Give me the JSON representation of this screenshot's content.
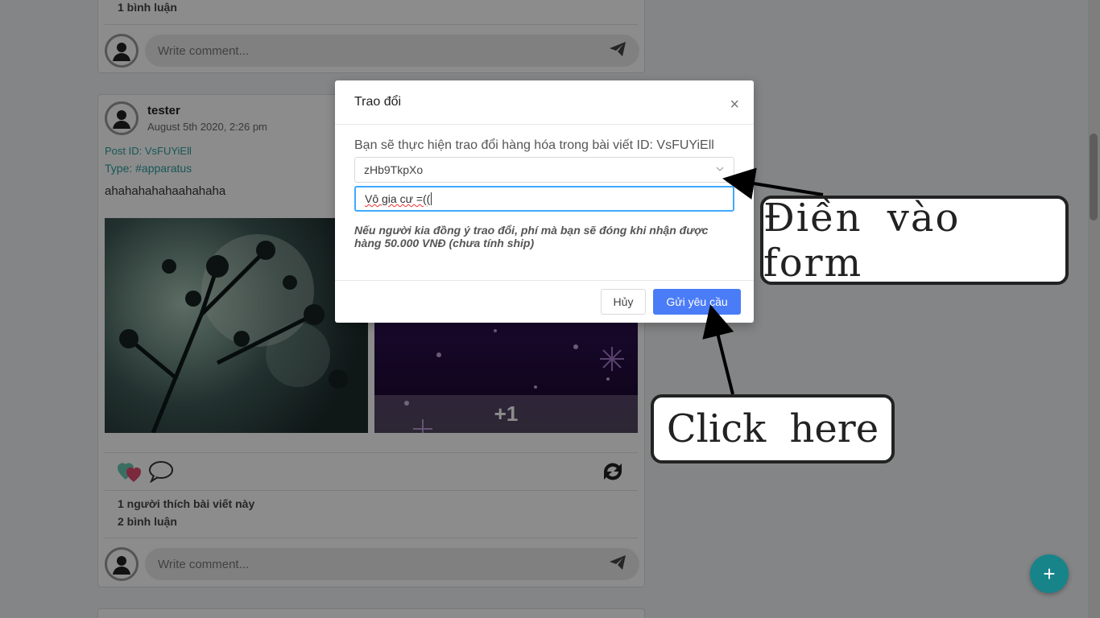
{
  "feed": {
    "post_prev": {
      "comments_count": "1 bình luận",
      "comment_placeholder": "Write comment..."
    },
    "post": {
      "author": "tester",
      "date": "August 5th 2020, 2:26 pm",
      "post_id": "Post ID: VsFUYiEll",
      "type": "Type: #apparatus",
      "content": "ahahahahahaahahaha",
      "more_images": "+1",
      "likes": "1 người thích bài viết này",
      "comments_count": "2 bình luận",
      "comment_placeholder": "Write comment..."
    }
  },
  "modal": {
    "title": "Trao đổi",
    "close": "×",
    "description": "Bạn sẽ thực hiện trao đổi hàng hóa trong bài viết ID: VsFUYiEll",
    "select_value": "zHb9TkpXo",
    "input_value": "Vô gia cư =((",
    "note": "Nếu người kia đồng ý trao đổi, phí mà bạn sẽ đóng khi nhận được hàng 50.000 VNĐ (chưa tính ship)",
    "cancel_label": "Hủy",
    "submit_label": "Gửi yêu cầu"
  },
  "annotations": {
    "fill_form": "Điền vào form",
    "click_here": "Click here"
  },
  "fab_label": "+",
  "colors": {
    "primary": "#4a7cf7",
    "teal": "#17848a",
    "focus": "#40a9ff"
  }
}
